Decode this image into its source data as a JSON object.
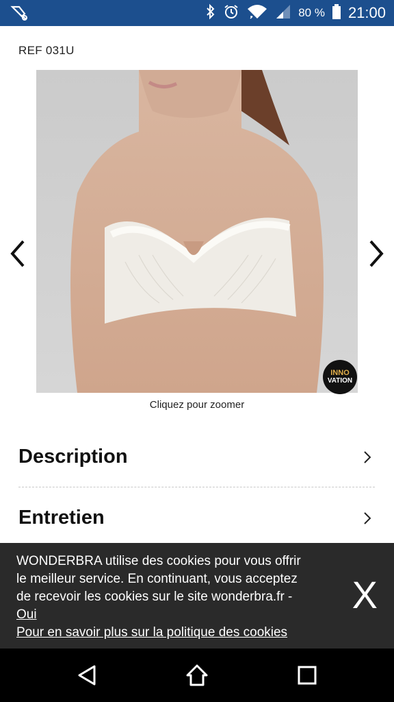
{
  "status_bar": {
    "battery_percent": "80 %",
    "time": "21:00",
    "icons": [
      "notification-icon",
      "bluetooth-icon",
      "alarm-icon",
      "wifi-icon",
      "signal-icon",
      "battery-icon"
    ]
  },
  "product": {
    "ref": "REF 031U",
    "badge_line1": "INNO",
    "badge_line2": "VATION",
    "zoom_hint": "Cliquez pour zoomer"
  },
  "sections": [
    {
      "label": "Description"
    },
    {
      "label": "Entretien"
    }
  ],
  "cookie_banner": {
    "text": "WONDERBRA utilise des cookies pour vous offrir le meilleur service. En continuant, vous acceptez de recevoir les cookies sur le site wonderbra.fr - ",
    "accept_link": "Oui",
    "policy_link": "Pour en savoir plus sur la politique des cookies",
    "close": "X"
  },
  "colors": {
    "status_bar": "#1c4f8e",
    "cookie_bg": "#2a2a2a",
    "nav_bg": "#000000"
  }
}
